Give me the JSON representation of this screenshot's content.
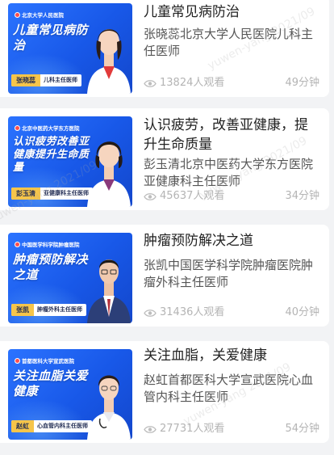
{
  "courses": [
    {
      "title": "儿童常见病防治",
      "doctor_hospital": "张晓蕊北京大学人民医院儿科主任医师",
      "views": "13824人观看",
      "duration": "49分钟",
      "thumb": {
        "hospital": "北京大学人民医院",
        "title": "儿童常见病防治",
        "name": "张晓蕊",
        "role": "儿科主任医师"
      }
    },
    {
      "title": "认识疲劳，改善亚健康，提升生命质量",
      "doctor_hospital": "彭玉清北京中医药大学东方医院亚健康科主任医师",
      "views": "45637人观看",
      "duration": "34分钟",
      "thumb": {
        "hospital": "北京中医药大学东方医院",
        "title": "认识疲劳改善亚健康提升生命质量",
        "name": "彭玉清",
        "role": "亚健康科主任医师"
      }
    },
    {
      "title": "肿瘤预防解决之道",
      "doctor_hospital": "张凯中国医学科学院肿瘤医院肿瘤外科主任医师",
      "views": "31436人观看",
      "duration": "40分钟",
      "thumb": {
        "hospital": "中国医学科学院肿瘤医院",
        "title": "肿瘤预防解决之道",
        "name": "张凯",
        "role": "肿瘤外科主任医师"
      }
    },
    {
      "title": "关注血脂，关爱健康",
      "doctor_hospital": "赵虹首都医科大学宣武医院心血管内科主任医师",
      "views": "27731人观看",
      "duration": "54分钟",
      "thumb": {
        "hospital": "首都医科大学宣武医院",
        "title": "关注血脂关爱健康",
        "name": "赵虹",
        "role": "心血管内科主任医师"
      }
    }
  ],
  "watermark": "yuwen-yang 2021/09",
  "icons": {
    "views": "eye-icon"
  },
  "colors": {
    "thumb_blue": "#1f63f2",
    "badge_yellow": "#f6c54a",
    "meta_gray": "#b4b4b4"
  }
}
